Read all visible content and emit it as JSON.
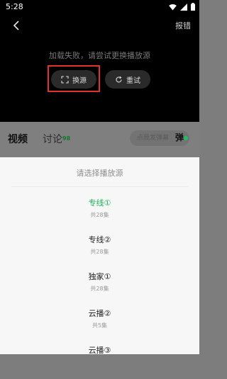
{
  "status_bar": {
    "time": "5:28"
  },
  "player": {
    "report_label": "报错",
    "error_message": "加载失败，请尝试更换播放源",
    "switch_source_label": "换源",
    "retry_label": "重试"
  },
  "tabs": {
    "video_label": "视频",
    "discuss_label": "讨论",
    "discuss_count": "98",
    "danmaku_placeholder": "点我发弹幕",
    "danmaku_toggle": "弹"
  },
  "sheet": {
    "title": "请选择播放源",
    "sources": [
      {
        "name": "专线①",
        "count": "共28集",
        "selected": true
      },
      {
        "name": "专线②",
        "count": "共28集",
        "selected": false
      },
      {
        "name": "独家①",
        "count": "共28集",
        "selected": false
      },
      {
        "name": "云播②",
        "count": "共5集",
        "selected": false
      },
      {
        "name": "云播③",
        "count": "",
        "selected": false
      }
    ]
  },
  "colors": {
    "accent_green": "#1bb455",
    "highlight_red": "#e0322f"
  }
}
